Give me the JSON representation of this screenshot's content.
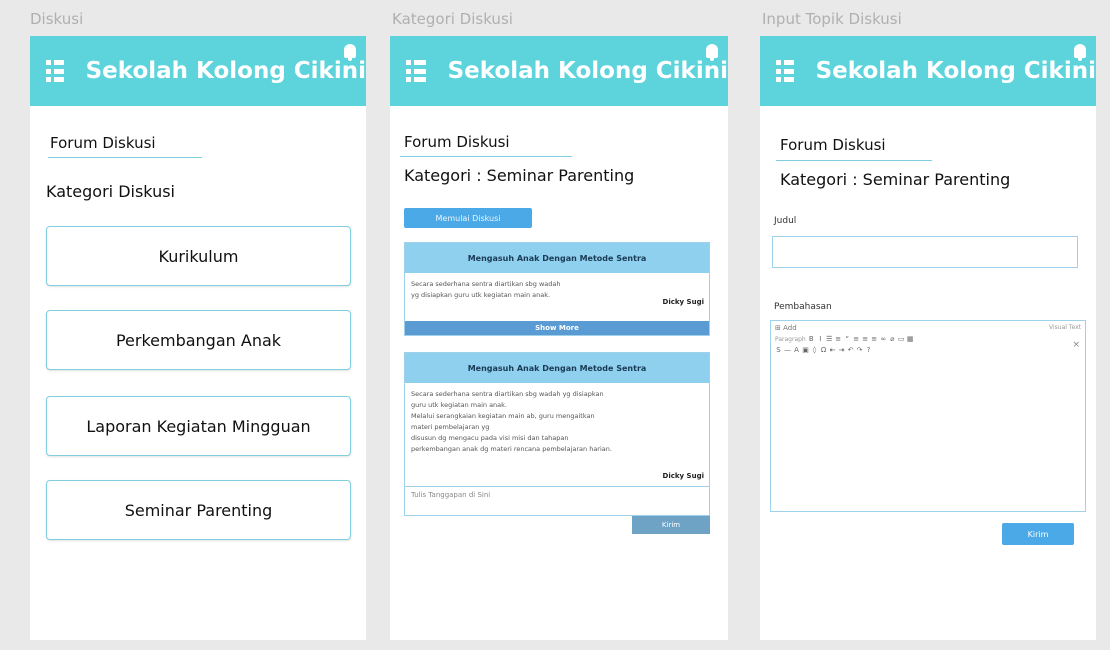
{
  "captions": [
    "Diskusi",
    "Kategori Diskusi",
    "Input Topik Diskusi"
  ],
  "app_title": "Sekolah Kolong Cikini",
  "forum_title": "Forum Diskusi",
  "panel1": {
    "heading": "Kategori Diskusi",
    "categories": [
      "Kurikulum",
      "Perkembangan Anak",
      "Laporan Kegiatan Mingguan",
      "Seminar Parenting"
    ]
  },
  "panel2": {
    "kategori": "Kategori : Seminar Parenting",
    "new_button": "Memulai Diskusi",
    "card1": {
      "title": "Mengasuh Anak Dengan Metode Sentra",
      "lines": [
        "Secara sederhana sentra diartikan sbg wadah",
        "yg disiapkan guru utk kegiatan main anak."
      ],
      "author": "Dicky Sugi",
      "show_more": "Show More"
    },
    "card2": {
      "title": "Mengasuh Anak Dengan Metode Sentra",
      "lines": [
        "Secara sederhana sentra diartikan sbg wadah yg disiapkan",
        "guru utk kegiatan main anak.",
        "Melalui serangkaian kegiatan main ab, guru mengaitkan",
        "materi pembelajaran yg",
        "disusun dg mengacu pada visi misi dan tahapan",
        "perkembangan anak dg materi rencana pembelajaran harian."
      ],
      "author": "Dicky Sugi"
    },
    "reply_placeholder": "Tulis Tanggapan di Sini",
    "send": "Kirim"
  },
  "panel3": {
    "kategori": "Kategori : Seminar Parenting",
    "judul_label": "Judul",
    "pembahasan_label": "Pembahasan",
    "editor_add": "Add",
    "editor_modes": "Visual  Text",
    "editor_paragraph": "Paragraph",
    "submit": "Kirim"
  }
}
